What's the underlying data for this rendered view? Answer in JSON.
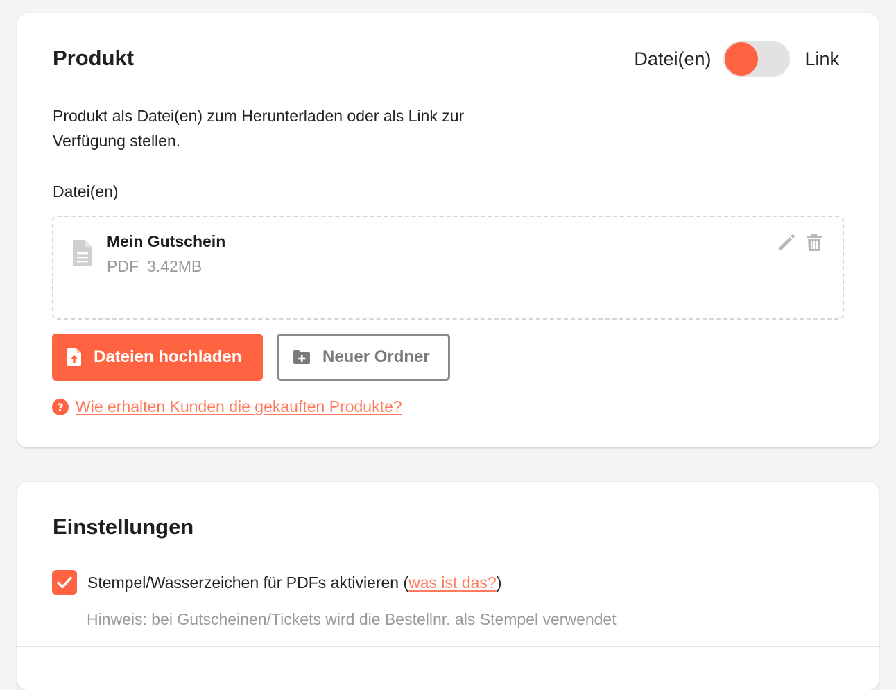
{
  "colors": {
    "accent": "#ff6341",
    "link": "#ff7a5c",
    "muted": "#9a9a9a",
    "toggle_track": "#e2e2e2"
  },
  "product": {
    "title": "Produkt",
    "toggle": {
      "left_label": "Datei(en)",
      "right_label": "Link",
      "selected": "Datei(en)"
    },
    "description": "Produkt als Datei(en) zum Herunterladen oder als Link zur Verfügung stellen.",
    "files_label": "Datei(en)",
    "files": [
      {
        "icon": "file-icon",
        "name": "Mein Gutschein",
        "type": "PDF",
        "size": "3.42MB"
      }
    ],
    "upload_button": "Dateien hochladen",
    "new_folder_button": "Neuer Ordner",
    "help_link": "Wie erhalten Kunden die gekauften Produkte?"
  },
  "settings": {
    "title": "Einstellungen",
    "watermark": {
      "checked": true,
      "label_before": "Stempel/Wasserzeichen für PDFs aktivieren (",
      "link": "was ist das?",
      "label_after": ")",
      "hint": "Hinweis: bei Gutscheinen/Tickets wird die Bestellnr. als Stempel verwendet"
    }
  }
}
